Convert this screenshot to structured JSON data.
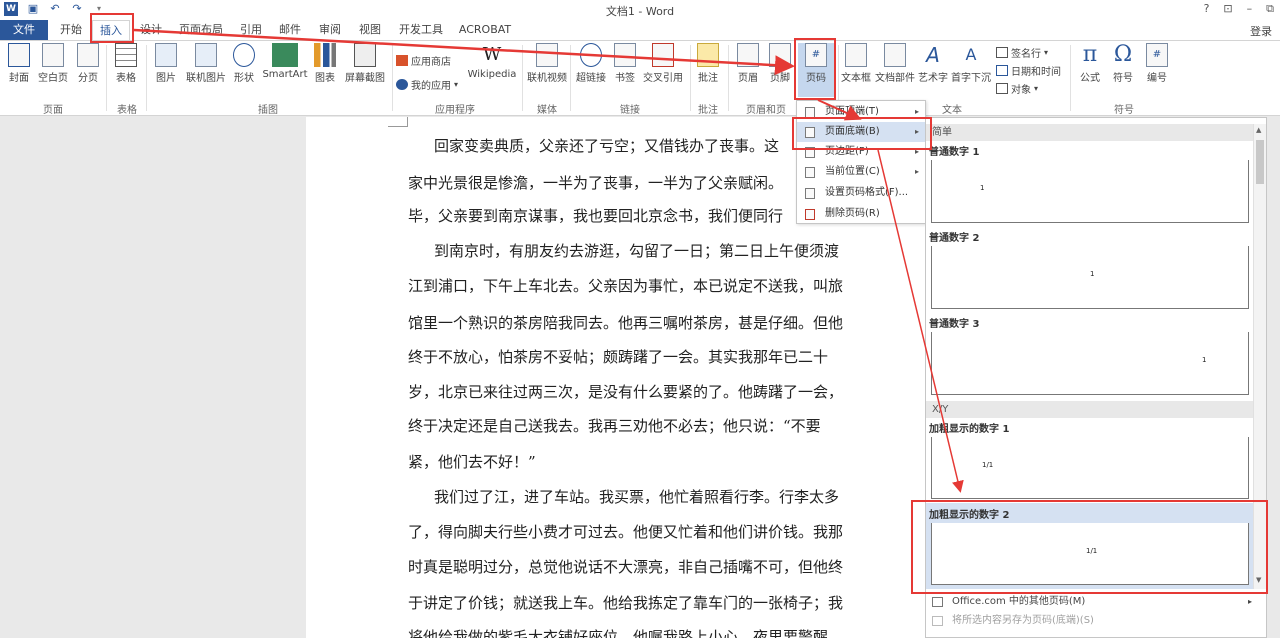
{
  "window": {
    "title": "文档1 - Word",
    "help": "?",
    "minimize": "–"
  },
  "tabs": [
    "文件",
    "开始",
    "插入",
    "设计",
    "页面布局",
    "引用",
    "邮件",
    "审阅",
    "视图",
    "开发工具",
    "ACROBAT"
  ],
  "signin": "登录",
  "ribbon": {
    "buttons": [
      "封面",
      "空白页",
      "分页",
      "表格",
      "图片",
      "联机图片",
      "形状",
      "SmartArt",
      "图表",
      "屏幕截图",
      "联机视频",
      "超链接",
      "书签",
      "交叉引用",
      "批注",
      "页眉",
      "页脚",
      "页码",
      "文本框",
      "文档部件",
      "艺术字",
      "首字下沉",
      "公式",
      "符号",
      "编号"
    ],
    "small": [
      "应用商店",
      "我的应用",
      "Wikipedia",
      "签名行",
      "日期和时间",
      "对象"
    ],
    "groups": [
      "页面",
      "表格",
      "插图",
      "应用程序",
      "媒体",
      "链接",
      "批注",
      "页眉和页",
      "文本",
      "符号"
    ]
  },
  "document": {
    "lines": [
      "回家变卖典质，父亲还了亏空；又借钱办了丧事。这",
      "家中光景很是惨澹，一半为了丧事，一半为了父亲赋闲。",
      "毕，父亲要到南京谋事，我也要回北京念书，我们便同行",
      "到南京时，有朋友约去游逛，勾留了一日；第二日上午便须渡",
      "江到浦口，下午上车北去。父亲因为事忙，本已说定不送我，叫旅",
      "馆里一个熟识的茶房陪我同去。他再三嘱咐茶房，甚是仔细。但他",
      "终于不放心，怕茶房不妥帖；颇踌躇了一会。其实我那年已二十",
      "岁，北京已来往过两三次，是没有什么要紧的了。他踌躇了一会，",
      "终于决定还是自己送我去。我再三劝他不必去；他只说：“不要",
      "紧，他们去不好！”",
      "我们过了江，进了车站。我买票，他忙着照看行李。行李太多",
      "了，得向脚夫行些小费才可过去。他便又忙着和他们讲价钱。我那",
      "时真是聪明过分，总觉他说话不大漂亮，非自己插嘴不可，但他终",
      "于讲定了价钱；就送我上车。他给我拣定了靠车门的一张椅子；我",
      "将他给我做的紫毛大衣铺好座位。他嘱我路上小心，夜里要警醒"
    ]
  },
  "menu": {
    "items": [
      {
        "label": "页面顶端(T)",
        "arrow": "▸"
      },
      {
        "label": "页面底端(B)",
        "arrow": "▸"
      },
      {
        "label": "页边距(P)",
        "arrow": "▸"
      },
      {
        "label": "当前位置(C)",
        "arrow": "▸"
      },
      {
        "label": "设置页码格式(F)...",
        "arrow": ""
      },
      {
        "label": "删除页码(R)",
        "arrow": ""
      }
    ]
  },
  "gallery": {
    "sections": [
      "简单",
      "X/Y"
    ],
    "items": [
      {
        "title": "普通数字 1",
        "num": "1"
      },
      {
        "title": "普通数字 2",
        "num": "1"
      },
      {
        "title": "普通数字 3",
        "num": "1"
      },
      {
        "title": "加粗显示的数字 1",
        "num": "1/1"
      },
      {
        "title": "加粗显示的数字 2",
        "num": "1/1"
      }
    ],
    "footer": [
      "Office.com 中的其他页码(M)",
      "将所选内容另存为页码(底端)(S)"
    ]
  },
  "colors": {
    "accent": "#2b579a",
    "annotation": "#e53935",
    "highlight": "#d5e1f2"
  }
}
